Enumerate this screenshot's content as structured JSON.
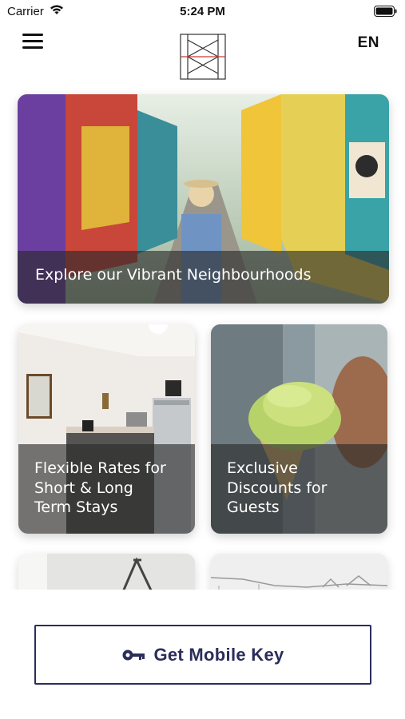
{
  "status_bar": {
    "carrier": "Carrier",
    "time": "5:24 PM",
    "wifi_icon": "wifi-icon",
    "battery_icon": "battery-icon"
  },
  "header": {
    "menu_icon": "hamburger-menu-icon",
    "logo": "hotel-h-logo",
    "language": "EN"
  },
  "cards": {
    "hero": {
      "title": "Explore our Vibrant Neighbourhoods"
    },
    "rates": {
      "title_lines": [
        "Flexible Rates for",
        "Short & Long",
        "Term Stays"
      ]
    },
    "discounts": {
      "title_lines": [
        "Exclusive",
        "Discounts for",
        "Guests"
      ]
    }
  },
  "footer": {
    "button_label": "Get Mobile Key",
    "button_icon": "key-icon",
    "accent_color": "#2b2e5b"
  }
}
